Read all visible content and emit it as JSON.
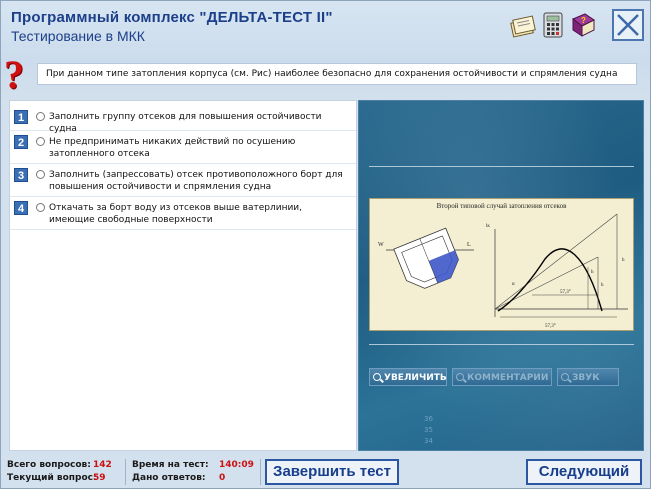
{
  "header": {
    "title": "Программный комплекс \"ДЕЛЬТА-ТЕСТ II\"",
    "subtitle": "Тестирование в МКК"
  },
  "question": {
    "text": "При данном типе затопления корпуса (см. Рис) наиболее безопасно для сохранения остойчивости и спрямления судна"
  },
  "answers": [
    {
      "num": "1",
      "text": "Заполнить группу отсеков для повышения остойчивости судна"
    },
    {
      "num": "2",
      "text": "Не предпринимать никаких действий по осушению затопленного отсека"
    },
    {
      "num": "3",
      "text": "Заполнить (запрессовать) отсек противоположного борт для повышения остойчивости и спрямления судна"
    },
    {
      "num": "4",
      "text": "Откачать за борт воду из отсеков выше ватерлинии, имеющие свободные поверхности"
    }
  ],
  "image_panel": {
    "diagram_title": "Второй типовой случай затопления отсеков",
    "labels": {
      "w": "W",
      "l": "L",
      "lk": "lк",
      "h_left": "h",
      "h_right": "h",
      "h_mid": "h",
      "a": "α",
      "angle": "57,3°",
      "angle2": "57,3°"
    },
    "buttons": {
      "zoom": "УВЕЛИЧИТЬ",
      "comment": "КОММЕНТАРИИ",
      "sound": "ЗВУК"
    },
    "faded_numbers": [
      "36",
      "35",
      "34"
    ]
  },
  "footer": {
    "total_label": "Всего вопросов:",
    "total_value": "142",
    "current_label": "Текущий вопрос:",
    "current_value": "59",
    "time_label": "Время на тест:",
    "time_value": "140:09",
    "answers_label": "Дано ответов:",
    "answers_value": "0",
    "finish_button": "Завершить тест",
    "next_button": "Следующий"
  },
  "colors": {
    "title": "#1c3f8a",
    "accent_red": "#cc1010",
    "answer_num_bg": "#3a6fb5",
    "image_panel_bg": "#245f86"
  },
  "icons": {
    "toolbar": [
      "notebook-icon",
      "calculator-icon",
      "help-book-icon",
      "close-icon"
    ],
    "question": "question-mark-icon",
    "buttons": "magnifier-icon"
  }
}
